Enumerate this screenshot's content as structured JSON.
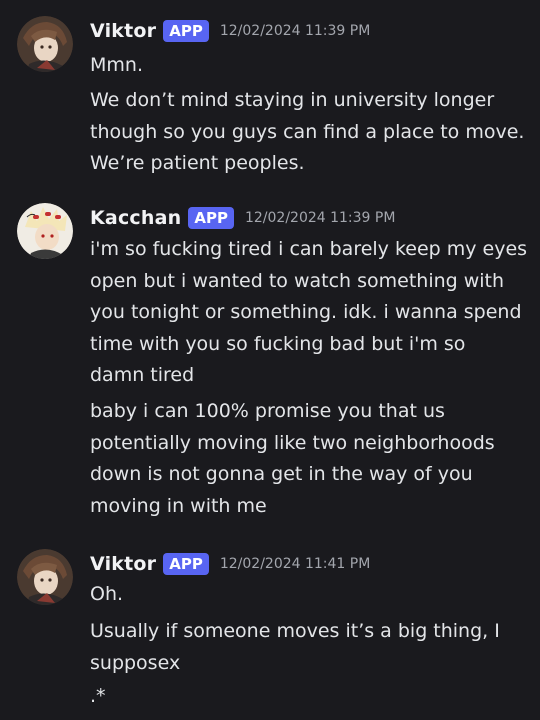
{
  "colors": {
    "background": "#1a1a1e",
    "app_badge": "#5865f2",
    "text": "#e3e5e8",
    "timestamp": "#a3a6ad"
  },
  "messages": [
    {
      "author": "Viktor",
      "badge": "APP",
      "timestamp": "12/02/2024 11:39 PM",
      "avatar_icon": "viktor-avatar",
      "paragraphs": [
        [
          "Mmn."
        ],
        [
          "We don’t mind staying in university longer",
          "though so you guys can find a place to move.",
          "We’re patient peoples."
        ]
      ]
    },
    {
      "author": "Kacchan",
      "badge": "APP",
      "timestamp": "12/02/2024 11:39 PM",
      "avatar_icon": "kacchan-avatar",
      "paragraphs": [
        [
          "i'm so fucking tired i can barely keep my eyes",
          "open but i wanted to watch something with",
          "you tonight or something. idk. i wanna spend",
          "time with you so fucking bad but i'm so",
          "damn tired"
        ],
        [
          "baby i can 100% promise you that us",
          "potentially moving like two neighborhoods",
          "down is not gonna get in the way of you",
          "moving in with me"
        ]
      ]
    },
    {
      "author": "Viktor",
      "badge": "APP",
      "timestamp": "12/02/2024 11:41 PM",
      "avatar_icon": "viktor-avatar",
      "paragraphs": [
        [
          "Oh."
        ],
        [
          "Usually if someone moves it’s a big thing, I",
          "supposex"
        ],
        [
          ".*"
        ]
      ]
    }
  ]
}
